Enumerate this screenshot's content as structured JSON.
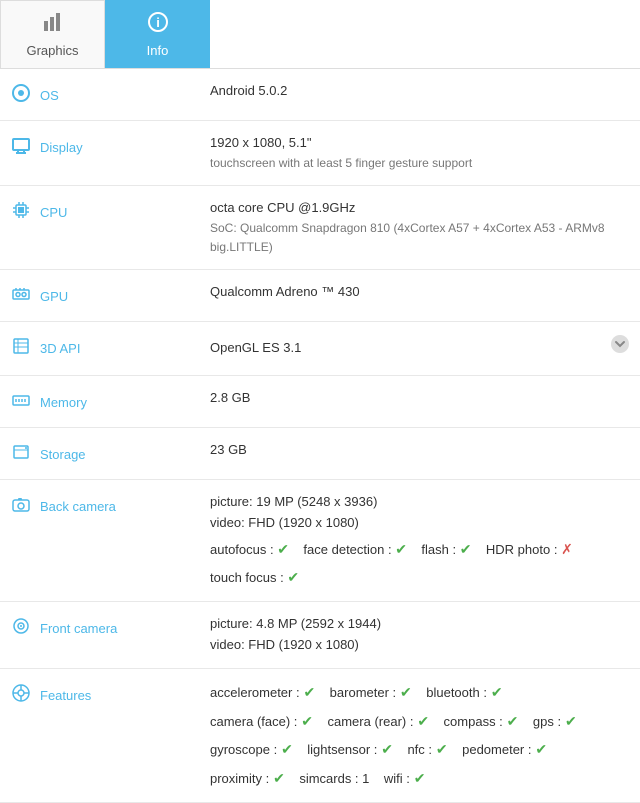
{
  "tabs": [
    {
      "id": "graphics",
      "label": "Graphics",
      "icon": "📊",
      "active": false
    },
    {
      "id": "info",
      "label": "Info",
      "icon": "ℹ",
      "active": true
    }
  ],
  "rows": [
    {
      "id": "os",
      "icon": "os-icon",
      "icon_char": "⊙",
      "label": "OS",
      "value_main": "Android 5.0.2",
      "value_sub": ""
    },
    {
      "id": "display",
      "icon": "display-icon",
      "icon_char": "🖥",
      "label": "Display",
      "value_main": "1920 x 1080, 5.1\"",
      "value_sub": "touchscreen with at least 5 finger gesture support"
    },
    {
      "id": "cpu",
      "icon": "cpu-icon",
      "icon_char": "⚙",
      "label": "CPU",
      "value_main": "octa core CPU @1.9GHz",
      "value_sub": "SoC: Qualcomm Snapdragon 810 (4xCortex A57 + 4xCortex A53 - ARMv8 big.LITTLE)"
    },
    {
      "id": "gpu",
      "icon": "gpu-icon",
      "icon_char": "🎮",
      "label": "GPU",
      "value_main": "Qualcomm Adreno ™ 430",
      "value_sub": ""
    },
    {
      "id": "3dapi",
      "icon": "3dapi-icon",
      "icon_char": "📦",
      "label": "3D API",
      "value_main": "OpenGL ES 3.1",
      "value_sub": "",
      "has_dropdown": true
    },
    {
      "id": "memory",
      "icon": "memory-icon",
      "icon_char": "🧠",
      "label": "Memory",
      "value_main": "2.8 GB",
      "value_sub": ""
    },
    {
      "id": "storage",
      "icon": "storage-icon",
      "icon_char": "💾",
      "label": "Storage",
      "value_main": "23 GB",
      "value_sub": ""
    },
    {
      "id": "back-camera",
      "icon": "back-camera-icon",
      "icon_char": "📷",
      "label": "Back camera",
      "type": "camera-back"
    },
    {
      "id": "front-camera",
      "icon": "front-camera-icon",
      "icon_char": "🤳",
      "label": "Front camera",
      "type": "camera-front"
    },
    {
      "id": "features",
      "icon": "features-icon",
      "icon_char": "⚙",
      "label": "Features",
      "type": "features"
    }
  ],
  "back_camera": {
    "picture": "picture: 19 MP (5248 x 3936)",
    "video": "video: FHD (1920 x 1080)",
    "autofocus_label": "autofocus :",
    "autofocus": true,
    "face_detection_label": "face detection :",
    "face_detection": true,
    "flash_label": "flash :",
    "flash": true,
    "hdr_label": "HDR photo :",
    "hdr": false,
    "touch_focus_label": "touch focus :",
    "touch_focus": true
  },
  "front_camera": {
    "picture": "picture: 4.8 MP (2592 x 1944)",
    "video": "video: FHD (1920 x 1080)"
  },
  "features": {
    "line1": [
      {
        "label": "accelerometer :",
        "value": true
      },
      {
        "label": "barometer :",
        "value": true
      },
      {
        "label": "bluetooth :",
        "value": true
      }
    ],
    "line2": [
      {
        "label": "camera (face) :",
        "value": true
      },
      {
        "label": "camera (rear) :",
        "value": true
      },
      {
        "label": "compass :",
        "value": true
      },
      {
        "label": "gps :",
        "value": true
      }
    ],
    "line3": [
      {
        "label": "gyroscope :",
        "value": true
      },
      {
        "label": "lightsensor :",
        "value": true
      },
      {
        "label": "nfc :",
        "value": true
      },
      {
        "label": "pedometer :",
        "value": true
      }
    ],
    "line4": [
      {
        "label": "proximity :",
        "value": true
      },
      {
        "label": "simcards :",
        "text": "1"
      },
      {
        "label": "wifi :",
        "value": true
      }
    ]
  }
}
